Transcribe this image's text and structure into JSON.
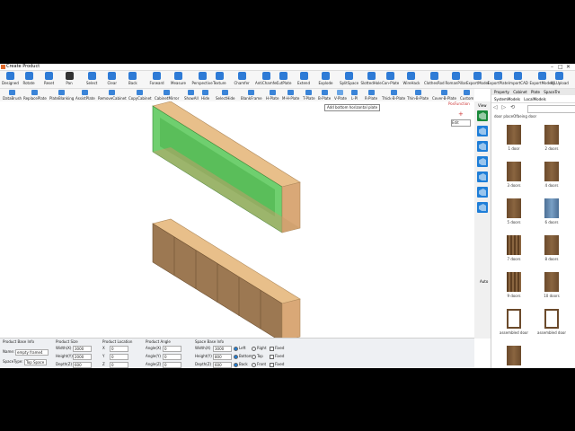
{
  "window": {
    "title": "Create Product"
  },
  "toolbar1": [
    {
      "label": "Designed",
      "icon": "designed-icon",
      "color": "#2e7bd6"
    },
    {
      "label": "Rotate",
      "icon": "rotate-icon",
      "color": "#2e7bd6"
    },
    {
      "label": "Reset",
      "icon": "reset-icon",
      "color": "#2e7bd6"
    },
    {
      "label": "Pan",
      "icon": "hand-icon",
      "color": "#333333"
    },
    {
      "label": "Select",
      "icon": "cursor-icon",
      "color": "#2e7bd6"
    },
    {
      "label": "Clear",
      "icon": "clear-icon",
      "color": "#2e7bd6"
    },
    {
      "label": "Back",
      "icon": "back-icon",
      "color": "#2e7bd6"
    },
    {
      "label": "Forward",
      "icon": "forward-icon",
      "color": "#2e7bd6"
    },
    {
      "label": "Measure",
      "icon": "measure-icon",
      "color": "#2e7bd6"
    },
    {
      "label": "Perspective",
      "icon": "perspective-icon",
      "color": "#2e7bd6"
    },
    {
      "label": "Texture",
      "icon": "texture-icon",
      "color": "#2e7bd6"
    },
    {
      "label": "Chamfer",
      "icon": "chamfer-icon",
      "color": "#2e7bd6"
    },
    {
      "label": "AntiChamfer",
      "icon": "antichamfer-icon",
      "color": "#2e7bd6"
    },
    {
      "label": "CutPlate",
      "icon": "cutplate-icon",
      "color": "#2e7bd6"
    },
    {
      "label": "Extend",
      "icon": "extend-icon",
      "color": "#2e7bd6"
    },
    {
      "label": "Explode",
      "icon": "explode-icon",
      "color": "#2e7bd6"
    },
    {
      "label": "SplitSpace",
      "icon": "splitspace-icon",
      "color": "#2e7bd6"
    },
    {
      "label": "SlottedHole",
      "icon": "slottedhole-icon",
      "color": "#2e7bd6"
    },
    {
      "label": "Con-Plate",
      "icon": "conplate-icon",
      "color": "#2e7bd6"
    },
    {
      "label": "WireHack",
      "icon": "wirehack-icon",
      "color": "#2e7bd6"
    },
    {
      "label": "ClothesRod",
      "icon": "clothesrod-icon",
      "color": "#2e7bd6"
    },
    {
      "label": "RomanPillar",
      "icon": "romanpillar-icon",
      "color": "#2e7bd6"
    },
    {
      "label": "ExportModel",
      "icon": "exportmodel-icon",
      "color": "#2e7bd6"
    },
    {
      "label": "ExportPlate",
      "icon": "exportplate-icon",
      "color": "#2e7bd6"
    },
    {
      "label": "ImportCAD",
      "icon": "importcad-icon",
      "color": "#2e7bd6"
    },
    {
      "label": "ExportModels",
      "icon": "exportmodels-icon",
      "color": "#2e7bd6"
    },
    {
      "label": "KJLUpload",
      "icon": "kjlupload-icon",
      "color": "#2e7bd6"
    }
  ],
  "toolbar2": [
    {
      "label": "DataBrush"
    },
    {
      "label": "ReplacePlate"
    },
    {
      "label": "PlateBlanking"
    },
    {
      "label": "AssistPlate"
    },
    {
      "label": "RemoveCabinet"
    },
    {
      "label": "CopyCabinet"
    },
    {
      "label": "CabinetMirror"
    },
    {
      "label": "ShowAll"
    },
    {
      "label": "Hide"
    },
    {
      "label": "SelectHide"
    },
    {
      "label": "BlankFrame"
    },
    {
      "label": "H-Plate"
    },
    {
      "label": "M-H-Plate"
    },
    {
      "label": "T-Plate"
    },
    {
      "label": "B-Plate"
    },
    {
      "label": "V-Plate"
    },
    {
      "label": "L-Pl"
    },
    {
      "label": "R-Plate"
    },
    {
      "label": "Thick-B-Plate"
    },
    {
      "label": "Thin-B-Plate"
    },
    {
      "label": "Cover-B-Plate"
    },
    {
      "label": "Custom"
    }
  ],
  "tooltip": "Add bottom horizontal plate",
  "canvas": {
    "position_function": "PosFunction",
    "plus": "+",
    "edit": "Edit"
  },
  "viewbar": {
    "label": "View",
    "auto": "Auto"
  },
  "panel": {
    "tabs": [
      "Property",
      "Cabinet",
      "Plate",
      "SpaceTre"
    ],
    "subtabs": [
      "SystemModels",
      "LocalModels"
    ],
    "nav": [
      "◁",
      "▷",
      "⟲"
    ],
    "crumb": "door placeOfbeing door",
    "items": [
      {
        "label": "1 door",
        "style": "plain"
      },
      {
        "label": "2 doors",
        "style": "plain"
      },
      {
        "label": "3 doors",
        "style": "plain"
      },
      {
        "label": "4 doors",
        "style": "plain"
      },
      {
        "label": "5 doors",
        "style": "plain"
      },
      {
        "label": "6 doors",
        "style": "sel"
      },
      {
        "label": "7 doors",
        "style": "stripe"
      },
      {
        "label": "8 doors",
        "style": "plain"
      },
      {
        "label": "9 doors",
        "style": "stripe"
      },
      {
        "label": "10 doors",
        "style": "plain"
      },
      {
        "label": "assembled door",
        "style": "frame"
      },
      {
        "label": "assembled door",
        "style": "frame"
      },
      {
        "label": "",
        "style": "plain"
      }
    ]
  },
  "bottom": {
    "base_info": {
      "title": "Product Base Info",
      "name_label": "Name:",
      "name_value": "empty frame4",
      "space_label": "SpaceType:",
      "space_value": "Top Space"
    },
    "size": {
      "title": "Product Size",
      "w_label": "Width(X)",
      "w": "3000",
      "h_label": "Height(Y)",
      "h": "2000",
      "d_label": "Depth(Z)",
      "d": "600"
    },
    "location": {
      "title": "Product Location",
      "x_label": "X",
      "x": "0",
      "y_label": "Y",
      "y": "0",
      "z_label": "Z",
      "z": "0"
    },
    "angle": {
      "title": "Product Angle",
      "x_label": "Angle(X)",
      "x": "0",
      "y_label": "Angle(Y)",
      "y": "0",
      "z_label": "Angle(Z)",
      "z": "0"
    },
    "space": {
      "title": "Space Base Info",
      "w_label": "Width(X)",
      "w": "3000",
      "h_label": "Height(Y)",
      "h": "800",
      "d_label": "Depth(Z)",
      "d": "600",
      "r1a": "Left",
      "r1b": "Right",
      "r2a": "Bottom",
      "r2b": "Top",
      "r3a": "Back",
      "r3b": "Front",
      "fixed": "Fixed"
    }
  }
}
